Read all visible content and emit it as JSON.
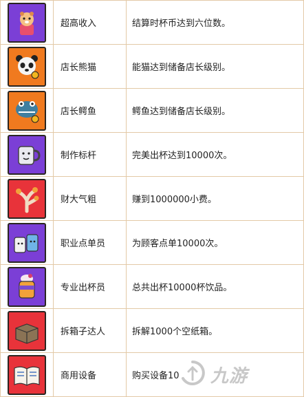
{
  "achievements": [
    {
      "icon": "hamster-cup-icon",
      "bg": "#7b3fd6",
      "name": "超高收入",
      "desc": "结算时杯币达到六位数。"
    },
    {
      "icon": "panda-icon",
      "bg": "#f07a1f",
      "name": "店长熊猫",
      "desc": "能猫达到储备店长级别。"
    },
    {
      "icon": "crocodile-icon",
      "bg": "#f07a1f",
      "name": "店长鳄鱼",
      "desc": "鳄鱼达到储备店长级别。"
    },
    {
      "icon": "mug-icon",
      "bg": "#7b3fd6",
      "name": "制作标杆",
      "desc": "完美出杯达到10000次。"
    },
    {
      "icon": "coral-icon",
      "bg": "#e8333a",
      "name": "财大气粗",
      "desc": "赚到1000000小费。"
    },
    {
      "icon": "cups-icon",
      "bg": "#7b3fd6",
      "name": "职业点单员",
      "desc": "为顾客点单10000次。"
    },
    {
      "icon": "drink-jar-icon",
      "bg": "#7b3fd6",
      "name": "专业出杯员",
      "desc": "总共出杯10000杯饮品。"
    },
    {
      "icon": "box-icon",
      "bg": "#e8333a",
      "name": "拆箱子达人",
      "desc": "拆解1000个空纸箱。"
    },
    {
      "icon": "book-icon",
      "bg": "#e8333a",
      "name": "商用设备",
      "desc": "购买设备10"
    }
  ],
  "watermark": {
    "text": "九游",
    "icon": "jiuyou-logo-icon"
  }
}
